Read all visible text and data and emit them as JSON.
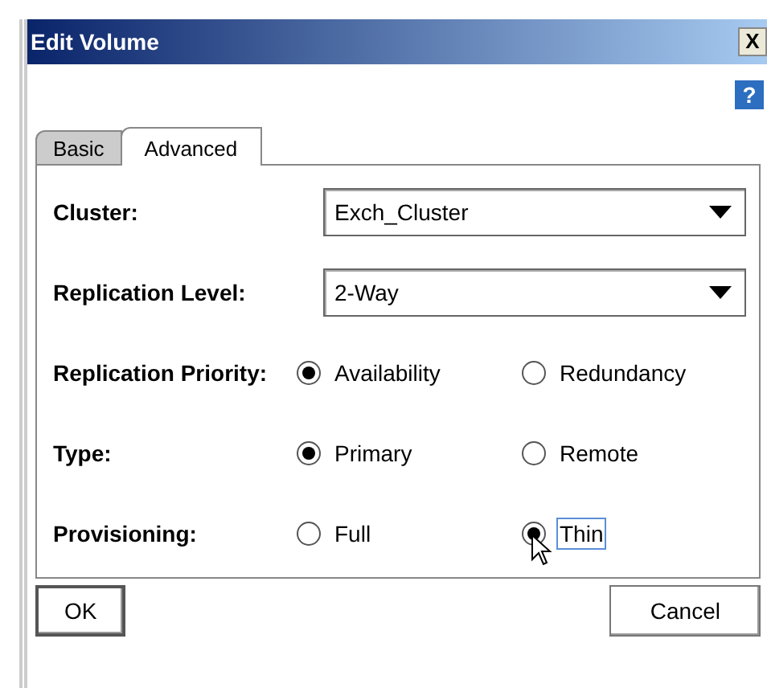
{
  "window": {
    "title": "Edit Volume",
    "close": "X",
    "help": "?"
  },
  "tabs": [
    {
      "label": "Basic",
      "selected": false
    },
    {
      "label": "Advanced",
      "selected": true
    }
  ],
  "fields": [
    {
      "kind": "dropdown",
      "label": "Cluster:",
      "value": "Exch_Cluster"
    },
    {
      "kind": "dropdown",
      "label": "Replication Level:",
      "value": "2-Way"
    },
    {
      "kind": "radio",
      "label": "Replication Priority:",
      "options": [
        {
          "label": "Availability",
          "selected": true,
          "focused": false
        },
        {
          "label": "Redundancy",
          "selected": false,
          "focused": false
        }
      ]
    },
    {
      "kind": "radio",
      "label": "Type:",
      "options": [
        {
          "label": "Primary",
          "selected": true,
          "focused": false
        },
        {
          "label": "Remote",
          "selected": false,
          "focused": false
        }
      ]
    },
    {
      "kind": "radio",
      "label": "Provisioning:",
      "options": [
        {
          "label": "Full",
          "selected": false,
          "focused": false
        },
        {
          "label": "Thin",
          "selected": true,
          "focused": true
        }
      ]
    }
  ],
  "buttons": [
    "OK",
    "Cancel"
  ]
}
